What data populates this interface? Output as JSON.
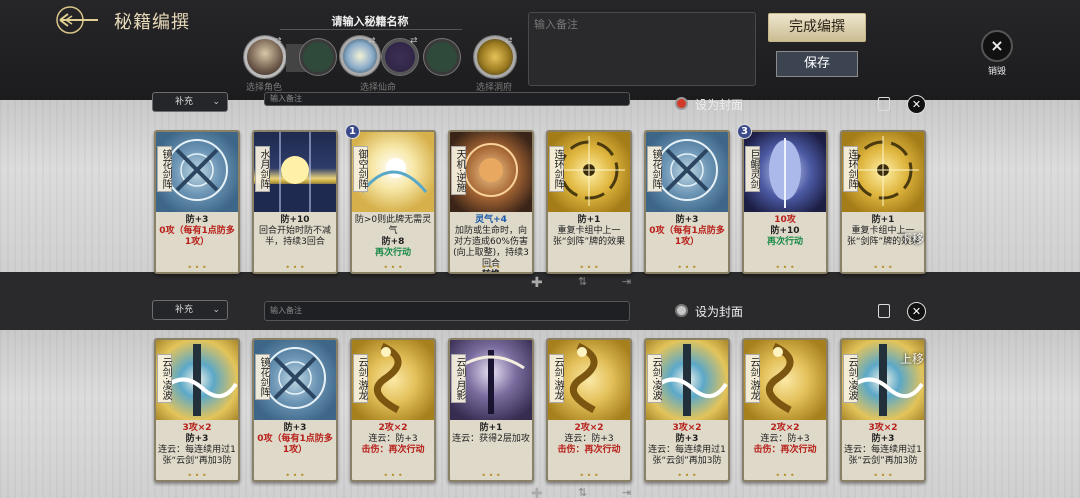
{
  "header": {
    "title": "秘籍编撰",
    "name_prompt": "请输入秘籍名称",
    "notes_placeholder": "输入备注",
    "finish_label": "完成编撰",
    "save_label": "保存",
    "destroy_label": "销毁",
    "slot_labels": {
      "character": "选择角色",
      "fate": "选择仙命",
      "academy": "选择洞府"
    }
  },
  "rows": [
    {
      "supplement_label": "补充",
      "note_placeholder": "输入备注",
      "cover_label": "设为封面",
      "cover_selected": true,
      "cards": [
        {
          "name": "镜花剑阵",
          "lines": [
            "防+3",
            "0攻（每有1点防多1攻）"
          ],
          "art": "mirror",
          "level": ""
        },
        {
          "name": "水月剑阵",
          "lines": [
            "防+10",
            "回合开始时防不减半，持续3回合"
          ],
          "art": "moon",
          "level": ""
        },
        {
          "name": "御空剑阵",
          "lines": [
            "防>0则此牌无需灵气",
            "防+8",
            "再次行动"
          ],
          "art": "sky",
          "level": "1"
        },
        {
          "name": "天机·逆施",
          "lines": [
            "灵气+4",
            "加防或生命时，向对方造成60%伤害(向上取整)，持续3回合",
            "转换"
          ],
          "art": "fate",
          "level": ""
        },
        {
          "name": "连环剑阵",
          "lines": [
            "防+1",
            "重复卡组中上一张“剑阵”牌的效果"
          ],
          "art": "gold",
          "level": ""
        },
        {
          "name": "镜花剑阵",
          "lines": [
            "防+3",
            "0攻（每有1点防多1攻）"
          ],
          "art": "mirror",
          "level": ""
        },
        {
          "name": "巨鲲灵剑",
          "lines": [
            "10攻",
            "防+10",
            "再次行动"
          ],
          "art": "whale",
          "level": "3"
        },
        {
          "name": "连环剑阵",
          "lines": [
            "防+1",
            "重复卡组中上一张“剑阵”牌的效果"
          ],
          "art": "gold",
          "level": "",
          "side": "下移"
        }
      ]
    },
    {
      "supplement_label": "补充",
      "note_placeholder": "输入备注",
      "cover_label": "设为封面",
      "cover_selected": false,
      "cards": [
        {
          "name": "云剑·凌波",
          "lines": [
            "3攻×2",
            "防+3",
            "连云：每连续用过1张“云剑”再加3防"
          ],
          "art": "cloud",
          "level": ""
        },
        {
          "name": "镜花剑阵",
          "lines": [
            "防+3",
            "0攻（每有1点防多1攻）"
          ],
          "art": "mirror",
          "level": ""
        },
        {
          "name": "云剑·游龙",
          "lines": [
            "2攻×2",
            "连云：防+3",
            "击伤：再次行动"
          ],
          "art": "dragon",
          "level": ""
        },
        {
          "name": "云剑·月影",
          "lines": [
            "防+1",
            "连云：获得2层加攻"
          ],
          "art": "shadow",
          "level": ""
        },
        {
          "name": "云剑·游龙",
          "lines": [
            "2攻×2",
            "连云：防+3",
            "击伤：再次行动"
          ],
          "art": "dragon",
          "level": ""
        },
        {
          "name": "云剑·凌波",
          "lines": [
            "3攻×2",
            "防+3",
            "连云：每连续用过1张“云剑”再加3防"
          ],
          "art": "cloud",
          "level": ""
        },
        {
          "name": "云剑·游龙",
          "lines": [
            "2攻×2",
            "连云：防+3",
            "击伤：再次行动"
          ],
          "art": "dragon",
          "level": ""
        },
        {
          "name": "云剑·凌波",
          "lines": [
            "3攻×2",
            "防+3",
            "连云：每连续用过1张“云剑”再加3防"
          ],
          "art": "cloud",
          "level": "",
          "side": "上移"
        }
      ]
    }
  ]
}
